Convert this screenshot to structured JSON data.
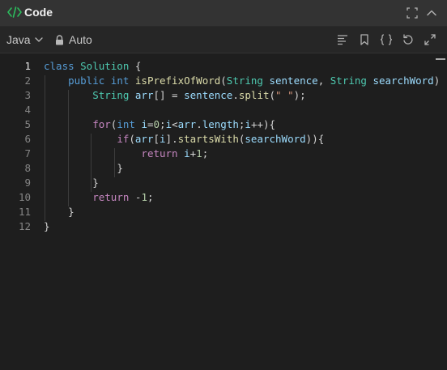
{
  "header": {
    "title": "Code",
    "icons": [
      "code-icon",
      "expand-icon",
      "collapse-icon"
    ]
  },
  "toolbar": {
    "language": "Java",
    "mode": "Auto",
    "icons": [
      "format-icon",
      "bookmark-icon",
      "braces-icon",
      "reset-icon",
      "fullscreen-icon"
    ]
  },
  "editor": {
    "lines": [
      {
        "n": "1",
        "tokens": [
          {
            "t": "class ",
            "c": "kw"
          },
          {
            "t": "Solution ",
            "c": "ty"
          },
          {
            "t": "{",
            "c": "pl"
          }
        ]
      },
      {
        "n": "2",
        "tokens": [
          {
            "t": "    ",
            "c": "pl"
          },
          {
            "t": "public ",
            "c": "kw"
          },
          {
            "t": "int ",
            "c": "kw"
          },
          {
            "t": "isPrefixOfWord",
            "c": "fn"
          },
          {
            "t": "(",
            "c": "pl"
          },
          {
            "t": "String ",
            "c": "ty"
          },
          {
            "t": "sentence",
            "c": "id"
          },
          {
            "t": ", ",
            "c": "pl"
          },
          {
            "t": "String ",
            "c": "ty"
          },
          {
            "t": "searchWord",
            "c": "id"
          },
          {
            "t": ") {",
            "c": "pl"
          }
        ]
      },
      {
        "n": "3",
        "tokens": [
          {
            "t": "        ",
            "c": "pl"
          },
          {
            "t": "String ",
            "c": "ty"
          },
          {
            "t": "arr",
            "c": "id"
          },
          {
            "t": "[] = ",
            "c": "pl"
          },
          {
            "t": "sentence",
            "c": "id"
          },
          {
            "t": ".",
            "c": "pl"
          },
          {
            "t": "split",
            "c": "fn"
          },
          {
            "t": "(",
            "c": "pl"
          },
          {
            "t": "\" \"",
            "c": "st"
          },
          {
            "t": ");",
            "c": "pl"
          }
        ]
      },
      {
        "n": "4",
        "tokens": []
      },
      {
        "n": "5",
        "tokens": [
          {
            "t": "        ",
            "c": "pl"
          },
          {
            "t": "for",
            "c": "kwp"
          },
          {
            "t": "(",
            "c": "pl"
          },
          {
            "t": "int ",
            "c": "kw"
          },
          {
            "t": "i",
            "c": "id"
          },
          {
            "t": "=",
            "c": "pl"
          },
          {
            "t": "0",
            "c": "nm"
          },
          {
            "t": ";",
            "c": "pl"
          },
          {
            "t": "i",
            "c": "id"
          },
          {
            "t": "<",
            "c": "pl"
          },
          {
            "t": "arr",
            "c": "id"
          },
          {
            "t": ".",
            "c": "pl"
          },
          {
            "t": "length",
            "c": "id"
          },
          {
            "t": ";",
            "c": "pl"
          },
          {
            "t": "i",
            "c": "id"
          },
          {
            "t": "++){",
            "c": "pl"
          }
        ]
      },
      {
        "n": "6",
        "tokens": [
          {
            "t": "            ",
            "c": "pl"
          },
          {
            "t": "if",
            "c": "kwp"
          },
          {
            "t": "(",
            "c": "pl"
          },
          {
            "t": "arr",
            "c": "id"
          },
          {
            "t": "[",
            "c": "pl"
          },
          {
            "t": "i",
            "c": "id"
          },
          {
            "t": "].",
            "c": "pl"
          },
          {
            "t": "startsWith",
            "c": "fn"
          },
          {
            "t": "(",
            "c": "pl"
          },
          {
            "t": "searchWord",
            "c": "id"
          },
          {
            "t": ")){",
            "c": "pl"
          }
        ]
      },
      {
        "n": "7",
        "tokens": [
          {
            "t": "                ",
            "c": "pl"
          },
          {
            "t": "return ",
            "c": "kwp"
          },
          {
            "t": "i",
            "c": "id"
          },
          {
            "t": "+",
            "c": "pl"
          },
          {
            "t": "1",
            "c": "nm"
          },
          {
            "t": ";",
            "c": "pl"
          }
        ]
      },
      {
        "n": "8",
        "tokens": [
          {
            "t": "            ",
            "c": "pl"
          },
          {
            "t": "}",
            "c": "pl"
          }
        ]
      },
      {
        "n": "9",
        "tokens": [
          {
            "t": "        ",
            "c": "pl"
          },
          {
            "t": "}",
            "c": "pl"
          }
        ]
      },
      {
        "n": "10",
        "tokens": [
          {
            "t": "        ",
            "c": "pl"
          },
          {
            "t": "return ",
            "c": "kwp"
          },
          {
            "t": "-",
            "c": "pl"
          },
          {
            "t": "1",
            "c": "nm"
          },
          {
            "t": ";",
            "c": "pl"
          }
        ]
      },
      {
        "n": "11",
        "tokens": [
          {
            "t": "    ",
            "c": "pl"
          },
          {
            "t": "}",
            "c": "pl"
          }
        ]
      },
      {
        "n": "12",
        "tokens": [
          {
            "t": "}",
            "c": "pl"
          }
        ]
      }
    ]
  }
}
